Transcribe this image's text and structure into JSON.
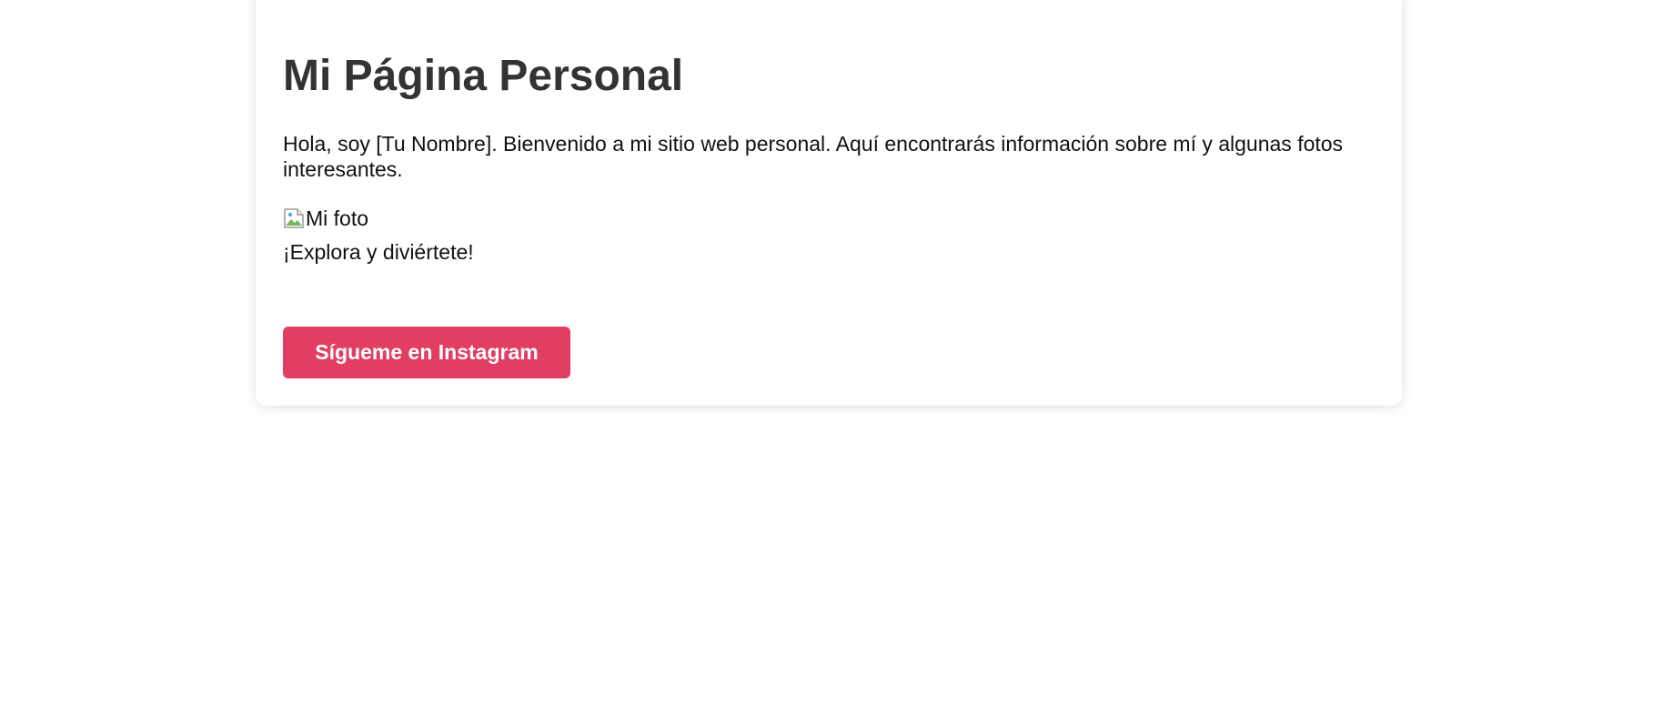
{
  "page": {
    "title": "Mi Página Personal",
    "intro": "Hola, soy [Tu Nombre]. Bienvenido a mi sitio web personal. Aquí encontrarás información sobre mí y algunas fotos interesantes.",
    "photo_alt": "Mi foto",
    "explore_text": "¡Explora y diviértete!",
    "button_label": "Sígueme en Instagram"
  },
  "colors": {
    "background": "#ffffff",
    "card": "#ffffff",
    "title": "#333333",
    "button": "#e23e63",
    "button_text": "#ffffff"
  },
  "icons": {
    "photo": "broken-image-icon"
  }
}
